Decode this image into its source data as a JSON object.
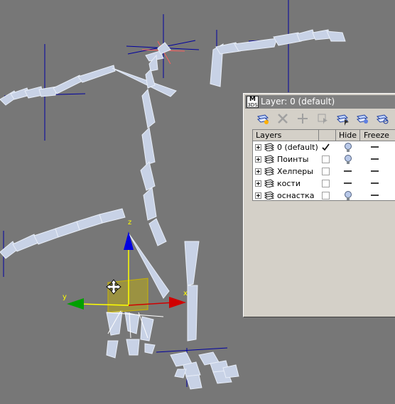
{
  "dialog": {
    "logo_top": "M",
    "logo_bottom": "3DS",
    "title": "Layer: 0 (default)"
  },
  "toolbar": {
    "buttons": [
      {
        "icon": "create-new-layer-icon",
        "enabled": true
      },
      {
        "icon": "delete-layer-icon",
        "enabled": false
      },
      {
        "icon": "add-selection-to-layer-icon",
        "enabled": false
      },
      {
        "icon": "select-objects-in-layer-icon",
        "enabled": false
      },
      {
        "icon": "highlight-selected-layer-icon",
        "enabled": true
      },
      {
        "icon": "hide-unhide-all-icon",
        "enabled": true
      },
      {
        "icon": "freeze-unfreeze-all-icon",
        "enabled": true
      }
    ]
  },
  "columns": {
    "layers": "Layers",
    "current": "",
    "hide": "Hide",
    "freeze": "Freeze"
  },
  "layers": [
    {
      "name": "0 (default)",
      "current": true,
      "hidden_icon": "lightbulb",
      "freeze_icon": "dash"
    },
    {
      "name": "Поинты",
      "current": false,
      "hidden_icon": "lightbulb",
      "freeze_icon": "dash"
    },
    {
      "name": "Хелперы",
      "current": false,
      "hidden_icon": "dash",
      "freeze_icon": "dash"
    },
    {
      "name": "кости",
      "current": false,
      "hidden_icon": "dash",
      "freeze_icon": "dash"
    },
    {
      "name": "оснастка",
      "current": false,
      "hidden_icon": "lightbulb",
      "freeze_icon": "dash"
    }
  ],
  "gizmo": {
    "x_label": "x",
    "y_label": "y",
    "z_label": "z",
    "colors": {
      "x": "#d00000",
      "y": "#00a000",
      "z": "#0000e0",
      "plane": "#c8b400"
    }
  },
  "viewport": {
    "background": "#777777",
    "bone_color": "#c8d2e6",
    "helper_color": "#0000a0"
  }
}
